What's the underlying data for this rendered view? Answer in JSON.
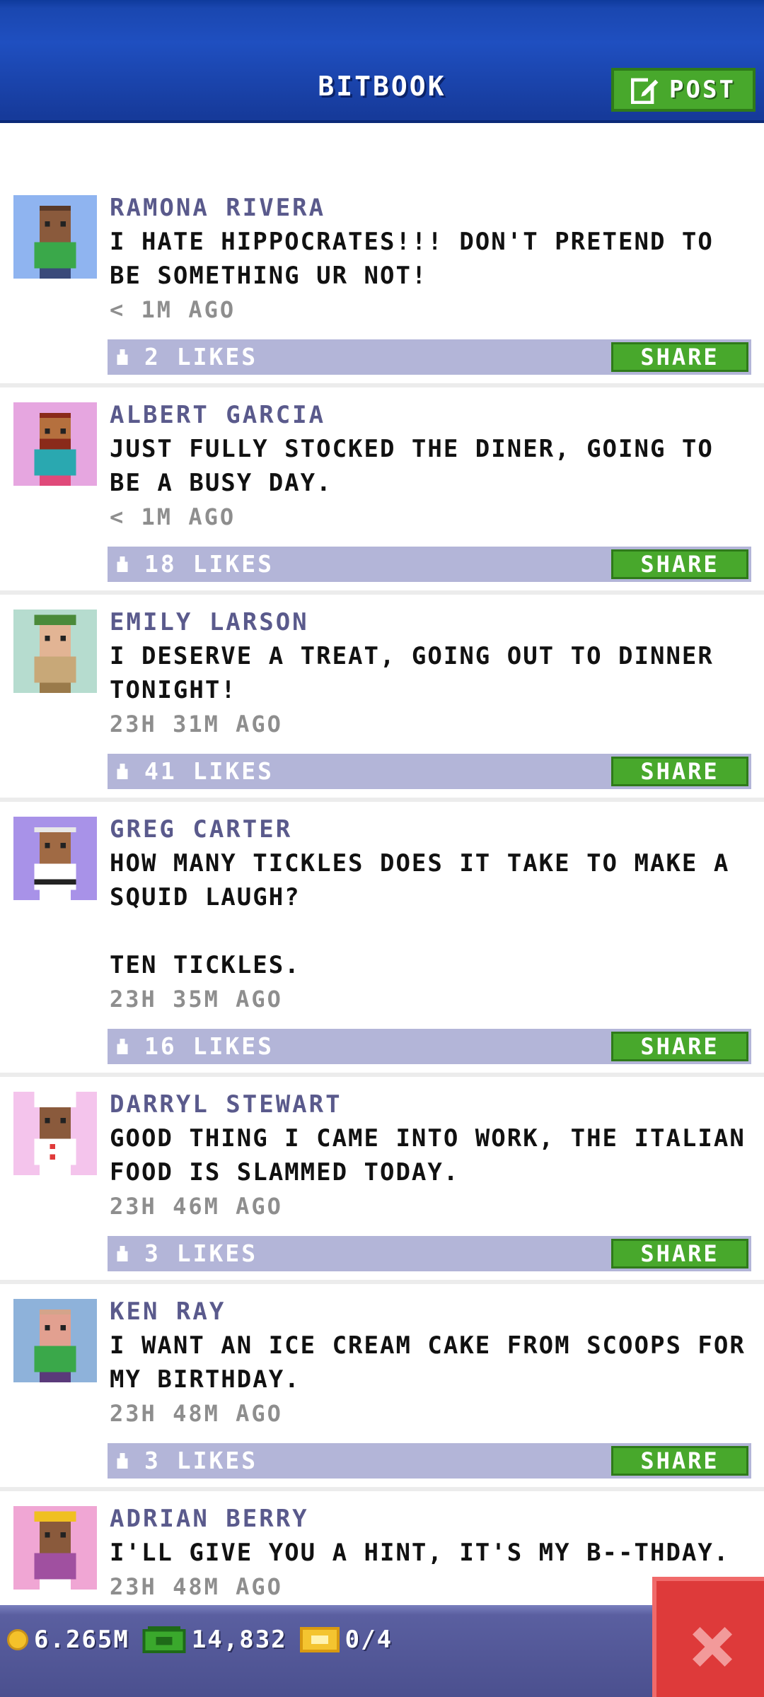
{
  "header": {
    "title": "BITBOOK",
    "post_label": "POST"
  },
  "posts": [
    {
      "author": "RAMONA RIVERA",
      "text": "I HATE HIPPOCRATES!!! DON'T PRETEND TO BE SOMETHING UR NOT!",
      "time": "< 1M AGO",
      "likes": "2 LIKES",
      "share": "SHARE",
      "avatar_bg": "#8fb4f0",
      "skin": "#8a5a3c",
      "shirt": "#3aa84a",
      "hair": "#5a3a28"
    },
    {
      "author": "ALBERT GARCIA",
      "text": "JUST FULLY STOCKED THE DINER, GOING TO BE A BUSY DAY.",
      "time": "< 1M AGO",
      "likes": "18 LIKES",
      "share": "SHARE",
      "avatar_bg": "#e6a6e0",
      "skin": "#b5703e",
      "shirt": "#2aa8b0",
      "hair": "#8a2a1a"
    },
    {
      "author": "EMILY LARSON",
      "text": "I DESERVE A TREAT, GOING OUT TO DINNER TONIGHT!",
      "time": "23H 31M AGO",
      "likes": "41 LIKES",
      "share": "SHARE",
      "avatar_bg": "#b6dccf",
      "skin": "#e2b494",
      "shirt": "#c8a878",
      "hair": "#4a8a3a"
    },
    {
      "author": "GREG CARTER",
      "text": "HOW MANY TICKLES DOES IT TAKE TO MAKE A SQUID LAUGH?\n\nTEN TICKLES.",
      "time": "23H 35M AGO",
      "likes": "16 LIKES",
      "share": "SHARE",
      "avatar_bg": "#a892e8",
      "skin": "#a06a44",
      "shirt": "#ffffff",
      "hair": "#e8e8e8"
    },
    {
      "author": "DARRYL STEWART",
      "text": "GOOD THING I CAME INTO WORK, THE ITALIAN FOOD IS SLAMMED TODAY.",
      "time": "23H 46M AGO",
      "likes": "3 LIKES",
      "share": "SHARE",
      "avatar_bg": "#f4c4ec",
      "skin": "#8a5a3c",
      "shirt": "#ffffff",
      "hair": "#ffffff"
    },
    {
      "author": "KEN RAY",
      "text": "I WANT AN ICE CREAM CAKE FROM SCOOPS FOR MY BIRTHDAY.",
      "time": "23H 48M AGO",
      "likes": "3 LIKES",
      "share": "SHARE",
      "avatar_bg": "#8eb2da",
      "skin": "#e2a090",
      "shirt": "#3aa84a",
      "hair": "#d4a48a"
    },
    {
      "author": "ADRIAN BERRY",
      "text": "I'LL GIVE YOU A HINT, IT'S MY B--THDAY.",
      "time": "23H 48M AGO",
      "likes": "",
      "share": "",
      "avatar_bg": "#f0a6d4",
      "skin": "#8a5a3c",
      "shirt": "#a050a0",
      "hair": "#f0c020"
    }
  ],
  "footer": {
    "coins": "6.265M",
    "bux": "14,832",
    "tickets": "0/4"
  }
}
